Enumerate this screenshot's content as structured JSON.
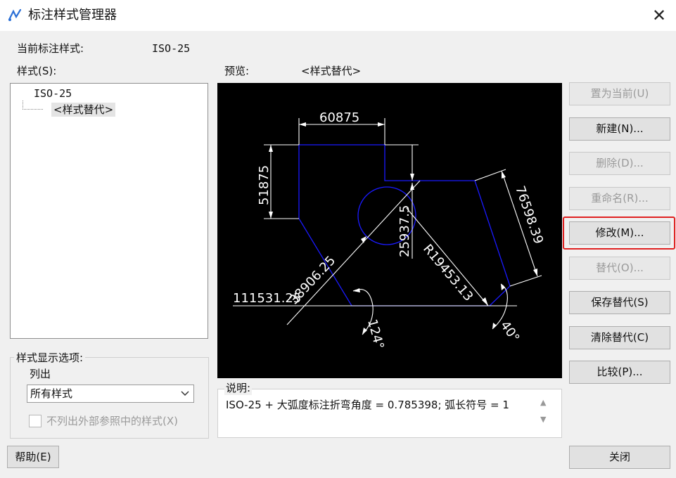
{
  "window": {
    "title": "标注样式管理器",
    "close": "✕"
  },
  "current_style": {
    "label": "当前标注样式:",
    "value": "ISO-25"
  },
  "styles": {
    "label": "样式(S):",
    "items": [
      {
        "label": "ISO-25"
      },
      {
        "label": "<样式替代>"
      }
    ]
  },
  "preview": {
    "label": "预览:",
    "value": "<样式替代>",
    "dims": {
      "top": "60875",
      "left": "51875",
      "right": "76598.39",
      "center_vertical": "25937.5",
      "diag_left": "38906.25",
      "diag_right": "R19453.13",
      "baseline": "111531.25",
      "angle_left": "124°",
      "angle_right": "40°"
    }
  },
  "display_options": {
    "label": "样式显示选项:",
    "list_label": "列出",
    "select_value": "所有样式",
    "checkbox_label": "不列出外部参照中的样式(X)"
  },
  "description": {
    "label": "说明:",
    "text": "ISO-25 + 大弧度标注折弯角度 = 0.785398; 弧长符号 = 1"
  },
  "buttons": {
    "set_current": "置为当前(U)",
    "new": "新建(N)...",
    "delete": "删除(D)...",
    "rename": "重命名(R)...",
    "modify": "修改(M)...",
    "override": "替代(O)...",
    "save_override": "保存替代(S)",
    "clear_override": "清除替代(C)",
    "compare": "比较(P)...",
    "close": "关闭",
    "help": "帮助(E)"
  },
  "colors": {
    "highlight": "#e02020",
    "geometry": "#1a1aff",
    "dimension": "#ffffff"
  }
}
